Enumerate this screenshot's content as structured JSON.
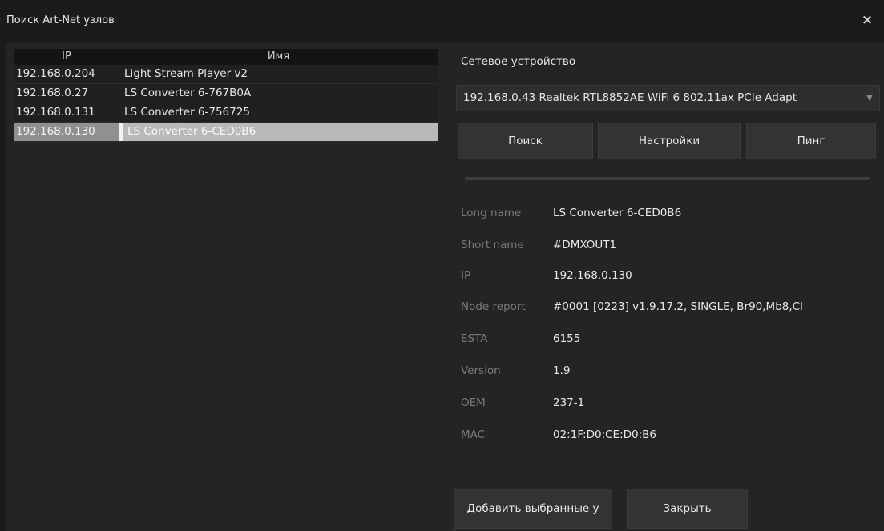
{
  "window": {
    "title": "Поиск Art-Net узлов",
    "close_glyph": "×"
  },
  "table": {
    "headers": [
      "IP",
      "Имя"
    ],
    "rows": [
      {
        "ip": "192.168.0.204",
        "name": "Light Stream Player v2"
      },
      {
        "ip": "192.168.0.27",
        "name": "LS Converter 6-767B0A"
      },
      {
        "ip": "192.168.0.131",
        "name": "LS Converter 6-756725"
      },
      {
        "ip": "192.168.0.130",
        "name": "LS Converter 6-CED0B6"
      }
    ],
    "selected_index": 3
  },
  "network": {
    "label": "Сетевое устройство",
    "selected": "192.168.0.43 Realtek RTL8852AE WiFi 6 802.11ax PCIe Adapt",
    "arrow_icon": "chevron-down-icon"
  },
  "buttons": {
    "search": "Поиск",
    "settings": "Настройки",
    "ping": "Пинг",
    "add_selected": "Добавить выбранные у",
    "close": "Закрыть"
  },
  "details": [
    {
      "label": "Long name",
      "value": "LS Converter 6-CED0B6"
    },
    {
      "label": "Short name",
      "value": "#DMXOUT1"
    },
    {
      "label": "IP",
      "value": "192.168.0.130"
    },
    {
      "label": "Node report",
      "value": "#0001 [0223] v1.9.17.2, SINGLE, Br90,Mb8,Cl"
    },
    {
      "label": "ESTA",
      "value": "6155"
    },
    {
      "label": "Version",
      "value": "1.9"
    },
    {
      "label": "OEM",
      "value": "237-1"
    },
    {
      "label": "MAC",
      "value": "02:1F:D0:CE:D0:B6"
    }
  ],
  "colors": {
    "background": "#1b1b1b",
    "panel": "#242424",
    "selected_row": "#b9b9b9",
    "button": "#333333"
  }
}
